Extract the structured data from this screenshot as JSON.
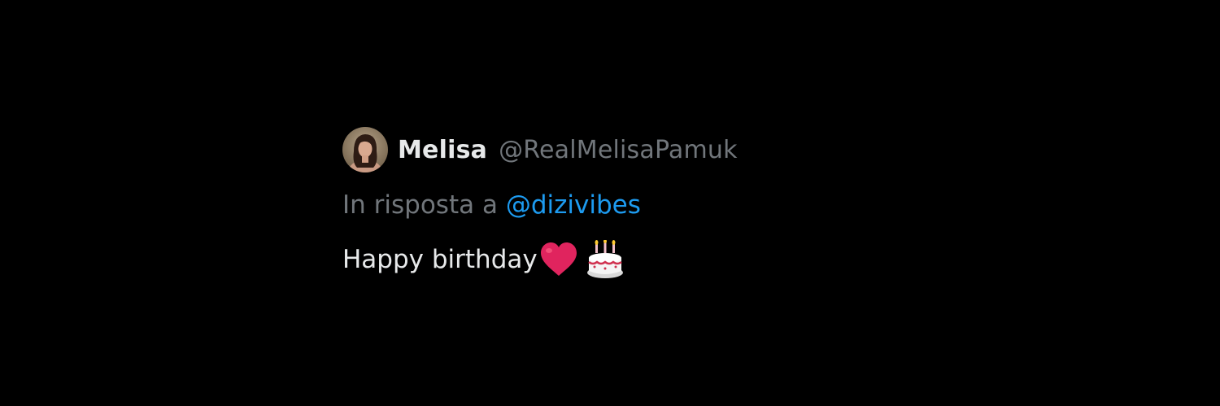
{
  "tweet": {
    "author": {
      "display_name": "Melisa",
      "handle": "@RealMelisaPamuk",
      "avatar_icon": "profile-photo"
    },
    "reply": {
      "prefix": "In risposta a",
      "mention": "@dizivibes"
    },
    "text": "Happy birthday",
    "emojis": [
      "red-heart-icon",
      "birthday-cake-icon"
    ]
  },
  "colors": {
    "background": "#000000",
    "primary_text": "#e7e9ea",
    "secondary_text": "#71767b",
    "link": "#1d9bf0",
    "heart": "#e0245e"
  }
}
